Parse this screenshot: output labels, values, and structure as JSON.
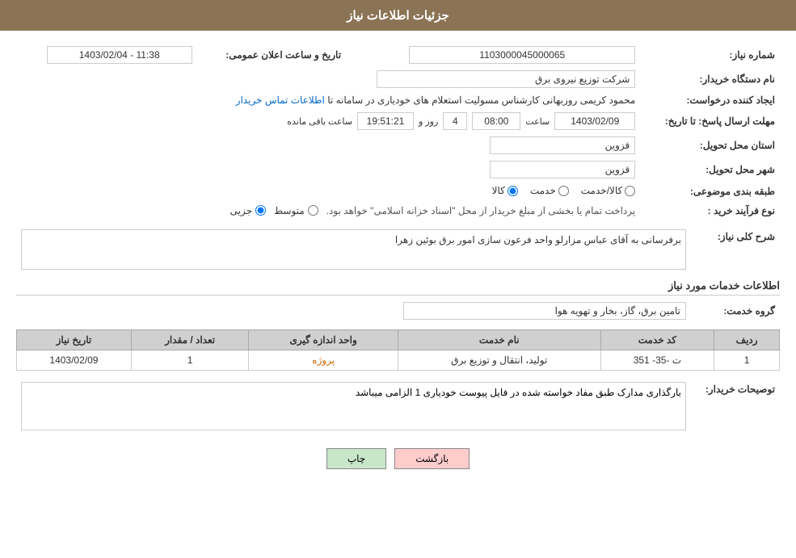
{
  "header": {
    "title": "جزئیات اطلاعات نیاز"
  },
  "fields": {
    "need_number_label": "شماره نیاز:",
    "need_number_value": "1103000045000065",
    "buyer_org_label": "نام دستگاه خریدار:",
    "buyer_org_value": "شرکت توزیع نیروی برق",
    "creator_label": "ایجاد کننده درخواست:",
    "creator_value": "محمود کریمی روزبهانی کارشناس  مسولیت استعلام های خودیاری در سامانه تا",
    "creator_link": "اطلاعات تماس خریدار",
    "deadline_label": "مهلت ارسال پاسخ: تا تاریخ:",
    "deadline_date": "1403/02/09",
    "deadline_time_label": "ساعت",
    "deadline_time": "08:00",
    "deadline_days_label": "روز و",
    "deadline_days": "4",
    "deadline_clock": "19:51:21",
    "deadline_remaining_label": "ساعت باقی مانده",
    "announce_label": "تاریخ و ساعت اعلان عمومی:",
    "announce_value": "1403/02/04 - 11:38",
    "province_label": "استان محل تحویل:",
    "province_value": "قزوین",
    "city_label": "شهر محل تحویل:",
    "city_value": "قزوین",
    "category_label": "طبقه بندی موضوعی:",
    "category_kala": "کالا",
    "category_khedmat": "خدمت",
    "category_kala_khedmat": "کالا/خدمت",
    "purchase_label": "نوع فرآیند خرید :",
    "purchase_jozi": "جزیی",
    "purchase_motavaset": "متوسط",
    "purchase_desc": "پرداخت تمام یا بخشی از مبلغ خریدار از محل \"اسناد خزانه اسلامی\" خواهد بود.",
    "need_desc_label": "شرح کلی نیاز:",
    "need_desc_value": "برفرسانی به آقای عباس مزارلو واحد فرعون سازی امور برق بوئین زهرا",
    "services_title": "اطلاعات خدمات مورد نیاز",
    "service_group_label": "گروه خدمت:",
    "service_group_value": "تامین برق، گاز، بخار و تهویه هوا"
  },
  "table": {
    "columns": [
      "ردیف",
      "کد خدمت",
      "نام خدمت",
      "واحد اندازه گیری",
      "تعداد / مقدار",
      "تاریخ نیاز"
    ],
    "rows": [
      {
        "row": "1",
        "code": "ت -35- 351",
        "name": "تولید، انتقال و توزیع برق",
        "unit": "پروژه",
        "count": "1",
        "date": "1403/02/09"
      }
    ]
  },
  "buyer_notes_label": "توصیحات خریدار:",
  "buyer_notes_value": "بارگذاری مدارک طبق مفاد خواسته شده در فایل پیوست خودیاری 1 الزامی میباشد",
  "buttons": {
    "print": "چاپ",
    "back": "بازگشت"
  }
}
